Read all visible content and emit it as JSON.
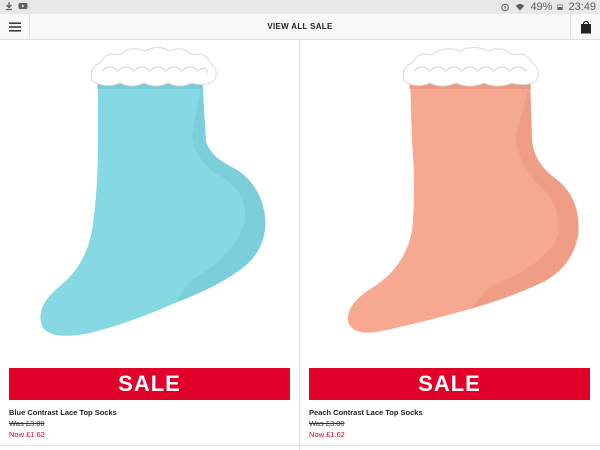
{
  "status_bar": {
    "left_icons": [
      "download-icon",
      "youtube-icon"
    ],
    "right_icons": [
      "alarm-icon",
      "wifi-icon",
      "battery-icon"
    ],
    "battery": "49%",
    "time": "23:49"
  },
  "header": {
    "title": "VIEW ALL SALE",
    "menu_icon": "hamburger-menu-icon",
    "bag_icon": "shopping-bag-icon"
  },
  "products": [
    {
      "name": "Blue Contrast Lace Top Socks",
      "was_price": "Was £3.00",
      "now_price": "Now £1.62",
      "badge": "SALE",
      "sock_color": "#86d8e2",
      "sock_shade": "#6cc6d2"
    },
    {
      "name": "Peach Contrast Lace Top Socks",
      "was_price": "Was £3.00",
      "now_price": "Now £1.62",
      "badge": "SALE",
      "sock_color": "#f6a890",
      "sock_shade": "#e8917a"
    }
  ],
  "colors": {
    "sale_red": "#e0002a",
    "lace_white": "#ffffff"
  }
}
